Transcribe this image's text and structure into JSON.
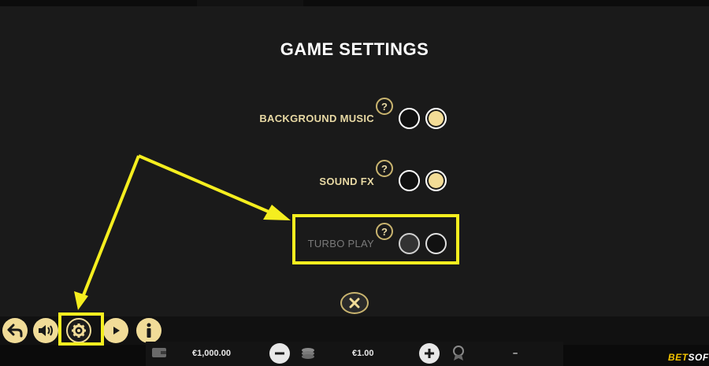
{
  "title": "GAME SETTINGS",
  "settings": [
    {
      "label": "BACKGROUND MUSIC",
      "help": "?",
      "state": "on"
    },
    {
      "label": "SOUND FX",
      "help": "?",
      "state": "on"
    },
    {
      "label": "TURBO PLAY",
      "help": "?",
      "state": "off",
      "disabled": true
    }
  ],
  "footer": {
    "balance": "€1,000.00",
    "bet": "€1.00",
    "win": "–",
    "brand_bet": "BET",
    "brand_soft": "SOFT"
  },
  "icons": {
    "close": "close-icon",
    "back": "back-icon",
    "sound": "speaker-icon",
    "settings": "gear-icon",
    "autoplay": "autoplay-icon",
    "info": "info-icon",
    "wallet": "wallet-icon",
    "minus": "minus-icon",
    "coins": "coins-icon",
    "plus": "plus-icon",
    "win": "award-icon"
  },
  "colors": {
    "accent": "#f1dc98",
    "annotation": "#f5ee1f",
    "background": "#1a1a1a"
  }
}
